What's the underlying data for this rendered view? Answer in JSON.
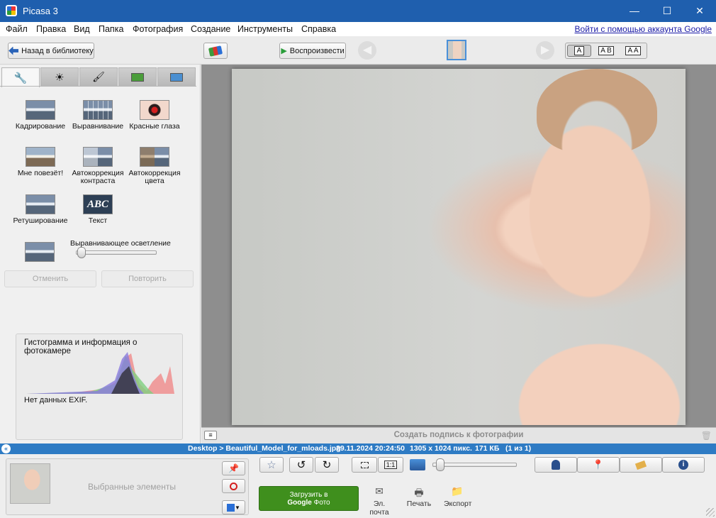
{
  "window": {
    "title": "Picasa 3",
    "minimize": "—",
    "maximize": "☐",
    "close": "✕"
  },
  "menu": {
    "items": [
      "Файл",
      "Правка",
      "Вид",
      "Папка",
      "Фотография",
      "Создание",
      "Инструменты",
      "Справка"
    ],
    "signin": "Войти с помощью аккаунта Google"
  },
  "toolbar": {
    "back_label": "Назад в библиотеку",
    "play_label": "Воспроизвести",
    "layout_single": "A",
    "layout_double": "A B",
    "layout_compare": "A A"
  },
  "tools": {
    "crop": "Кадрирование",
    "straighten": "Выравнивание",
    "redeye": "Красные глаза",
    "feeling_lucky": "Мне повезёт!",
    "auto_contrast": "Автокоррекция контраста",
    "auto_color": "Автокоррекция цвета",
    "retouch": "Ретуширование",
    "text": "Текст",
    "text_thumb": "ABC",
    "fill_light": "Выравнивающее осветление",
    "fill_light_value": 0.02,
    "undo": "Отменить",
    "redo": "Повторить"
  },
  "histogram": {
    "title": "Гистограмма и информация о фотокамере",
    "exif": "Нет данных EXIF."
  },
  "photo": {
    "caption_placeholder": "Создать подпись к фотографии"
  },
  "status": {
    "path": "Desktop > Beautiful_Model_for_mloads.jpg",
    "datetime": "29.11.2024 20:24:50",
    "dimensions": "1305 x 1024 пикс.",
    "size": "171 КБ",
    "position": "(1 из 1)"
  },
  "bottom": {
    "tray_label": "Выбранные элементы",
    "upload_line1": "Загрузить в",
    "upload_brand": "Google",
    "upload_suffix": "Фото",
    "zoom_fit": "1:1",
    "zoom_value": 0.05,
    "email": "Эл. почта",
    "print": "Печать",
    "export": "Экспорт"
  },
  "colors": {
    "titlebar": "#1f5fae",
    "statusbar": "#2e7bc4",
    "upload_button": "#3f8f1d",
    "link": "#1a1aa6"
  }
}
